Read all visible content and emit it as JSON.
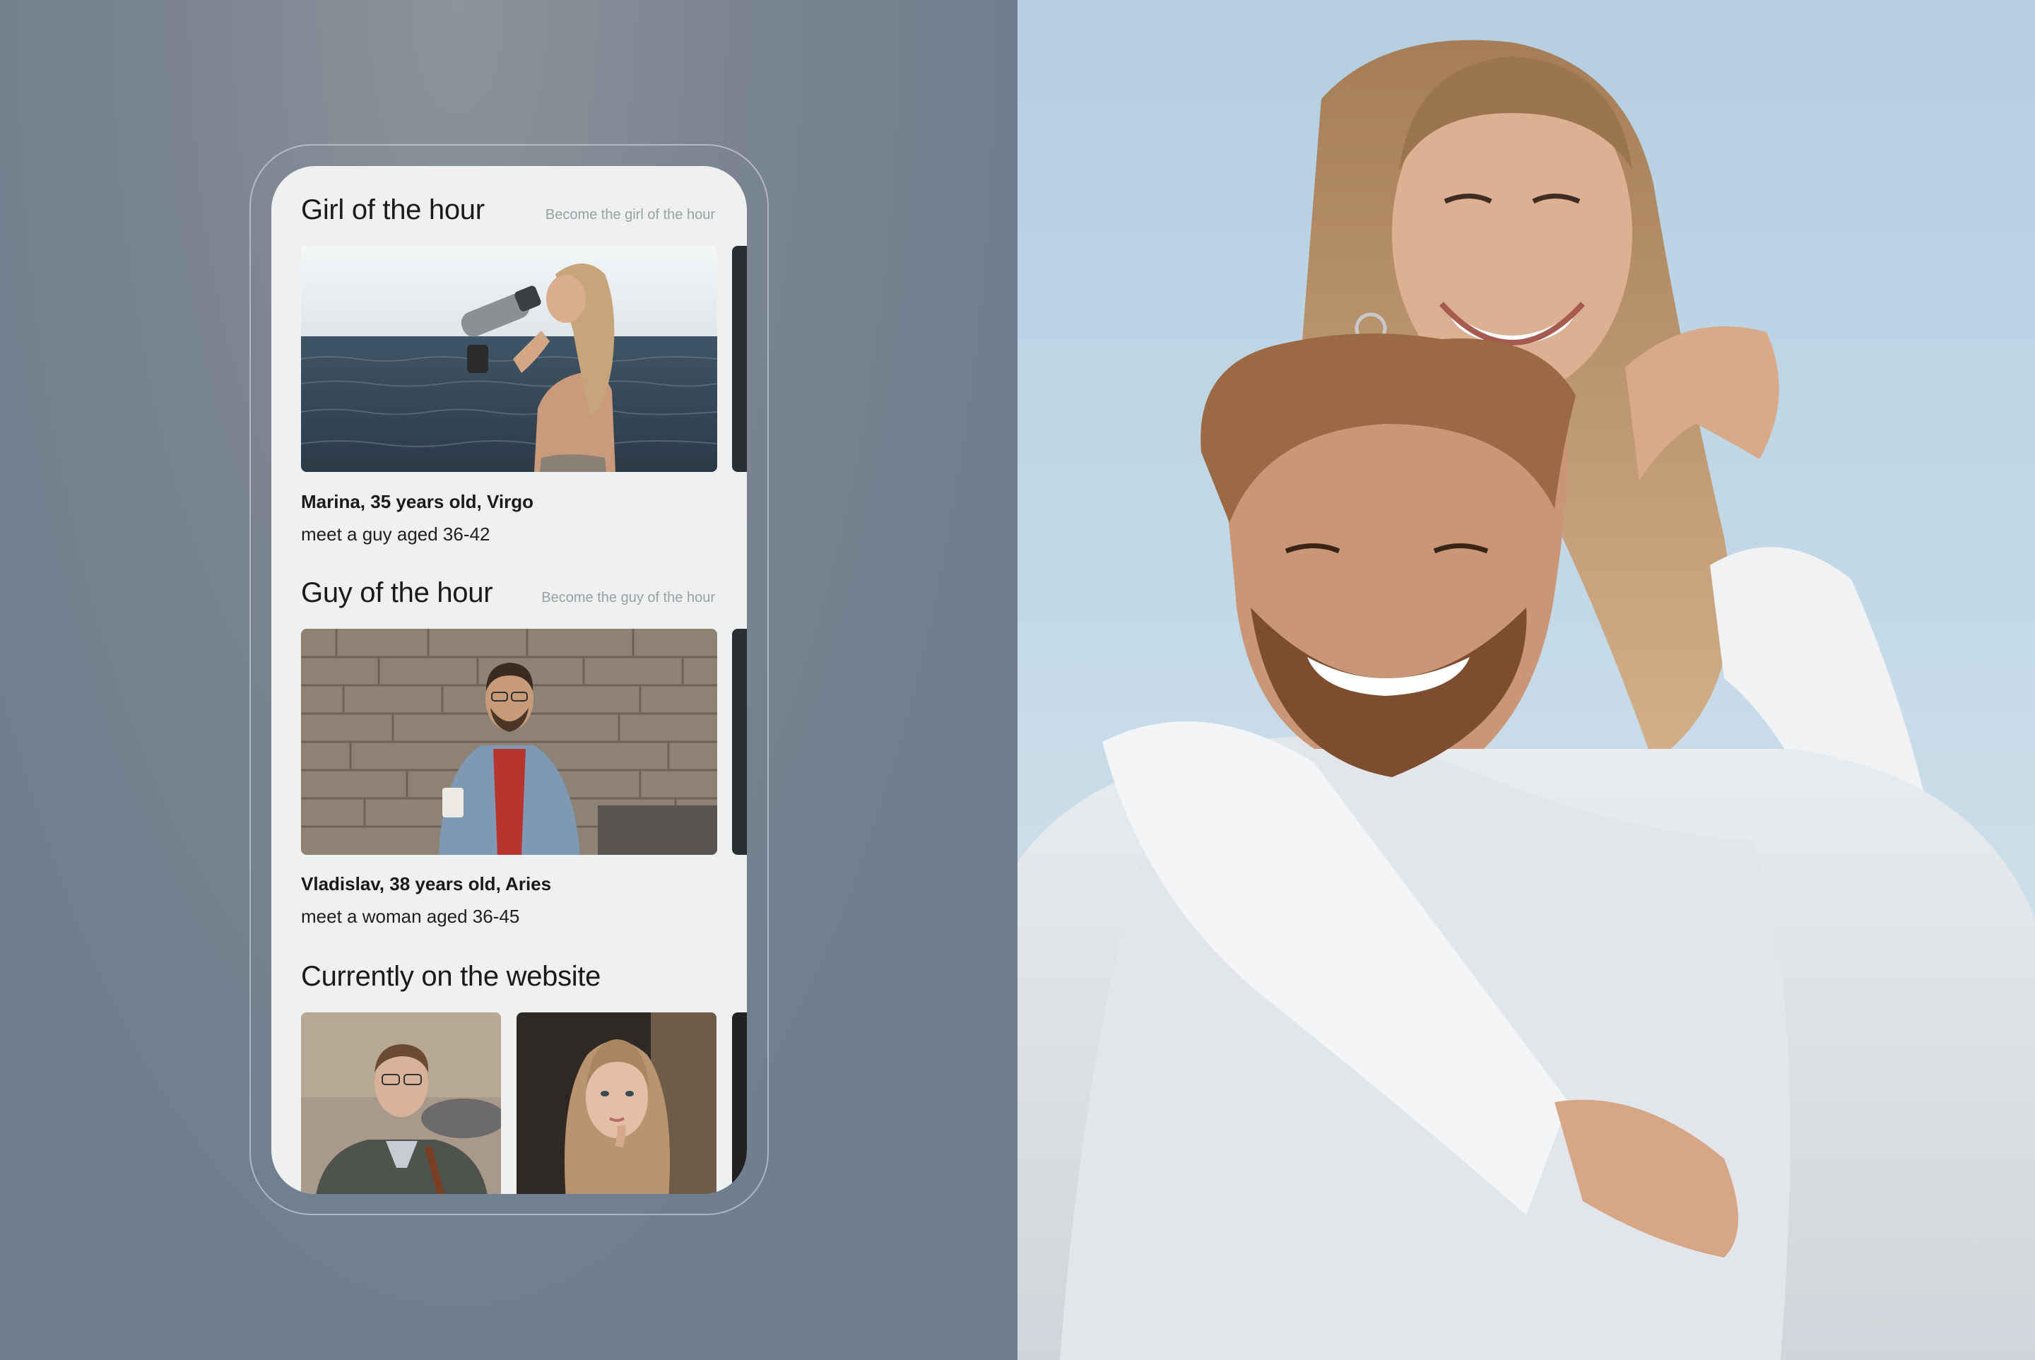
{
  "girl_section": {
    "title": "Girl of the hour",
    "link": "Become the girl of the hour",
    "name": "Marina, 35 years old, Virgo",
    "meta": "meet a guy aged 36-42"
  },
  "guy_section": {
    "title": "Guy of the hour",
    "link": "Become the guy of the hour",
    "name": "Vladislav, 38 years old, Aries",
    "meta": "meet a woman aged 36-45"
  },
  "online_section": {
    "title": "Currently on the website"
  },
  "colors": {
    "background_left": "#6f7f8e",
    "screen_bg": "#eff0f0",
    "title_text": "#1a1a1a",
    "link_text": "#9aa0a5",
    "sky": "#bcd4e3"
  }
}
